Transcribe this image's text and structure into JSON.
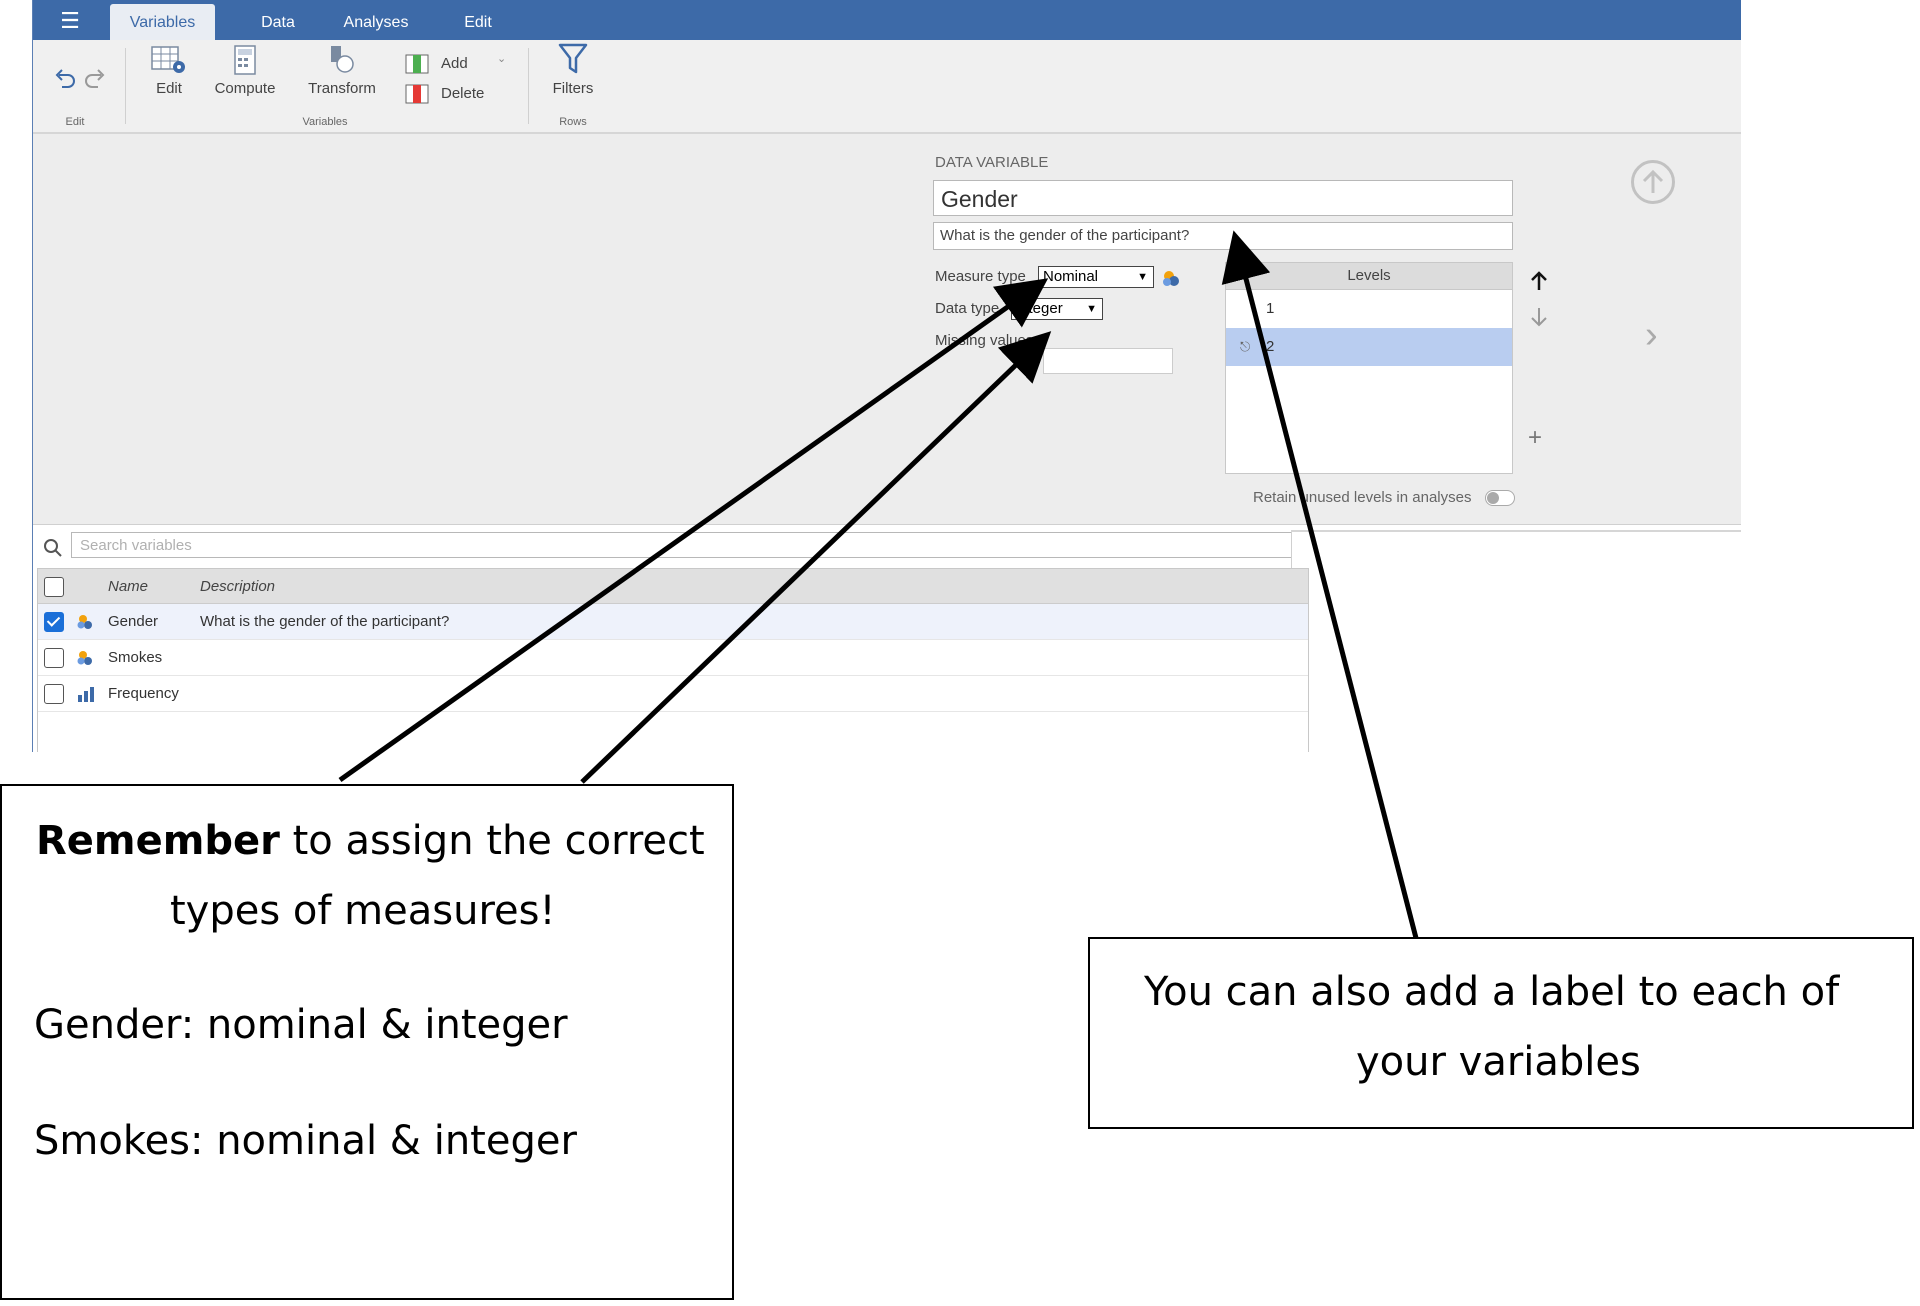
{
  "tabs": [
    {
      "label": "Variables",
      "active": true
    },
    {
      "label": "Data",
      "active": false
    },
    {
      "label": "Analyses",
      "active": false
    },
    {
      "label": "Edit",
      "active": false
    }
  ],
  "ribbon": {
    "edit_label": "Edit",
    "compute_label": "Compute",
    "transform_label": "Transform",
    "add_label": "Add",
    "delete_label": "Delete",
    "filters_label": "Filters",
    "groups": {
      "edit": "Edit",
      "variables": "Variables",
      "rows": "Rows"
    }
  },
  "variable": {
    "heading": "DATA VARIABLE",
    "name": "Gender",
    "description": "What is the gender of the participant?",
    "measure_type_label": "Measure type",
    "measure_type": "Nominal",
    "data_type_label": "Data type",
    "data_type": "Integer",
    "missing_values_label": "Missing values",
    "levels_header": "Levels",
    "levels": [
      "1",
      "2"
    ],
    "retain_label": "Retain unused levels in analyses",
    "retain_unused": false
  },
  "search": {
    "placeholder": "Search variables"
  },
  "table": {
    "headers": {
      "name": "Name",
      "description": "Description"
    },
    "rows": [
      {
        "name": "Gender",
        "description": "What is the gender of the participant?",
        "checked": true,
        "icon": "nominal-icon"
      },
      {
        "name": "Smokes",
        "description": "",
        "checked": false,
        "icon": "nominal-icon"
      },
      {
        "name": "Frequency",
        "description": "",
        "checked": false,
        "icon": "continuous-icon"
      }
    ]
  },
  "callouts": {
    "left": {
      "bold": "Remember",
      "line1_rest": " to assign the correct",
      "line2": "types of measures!",
      "line3": "Gender: nominal & integer",
      "line4": "Smokes: nominal & integer"
    },
    "right": {
      "line1": "You can also add a label to each of",
      "line2": "your variables"
    }
  },
  "colors": {
    "accent": "#3d6aa8",
    "selection": "#b9cdf0",
    "checkbox": "#1a6fd8"
  }
}
